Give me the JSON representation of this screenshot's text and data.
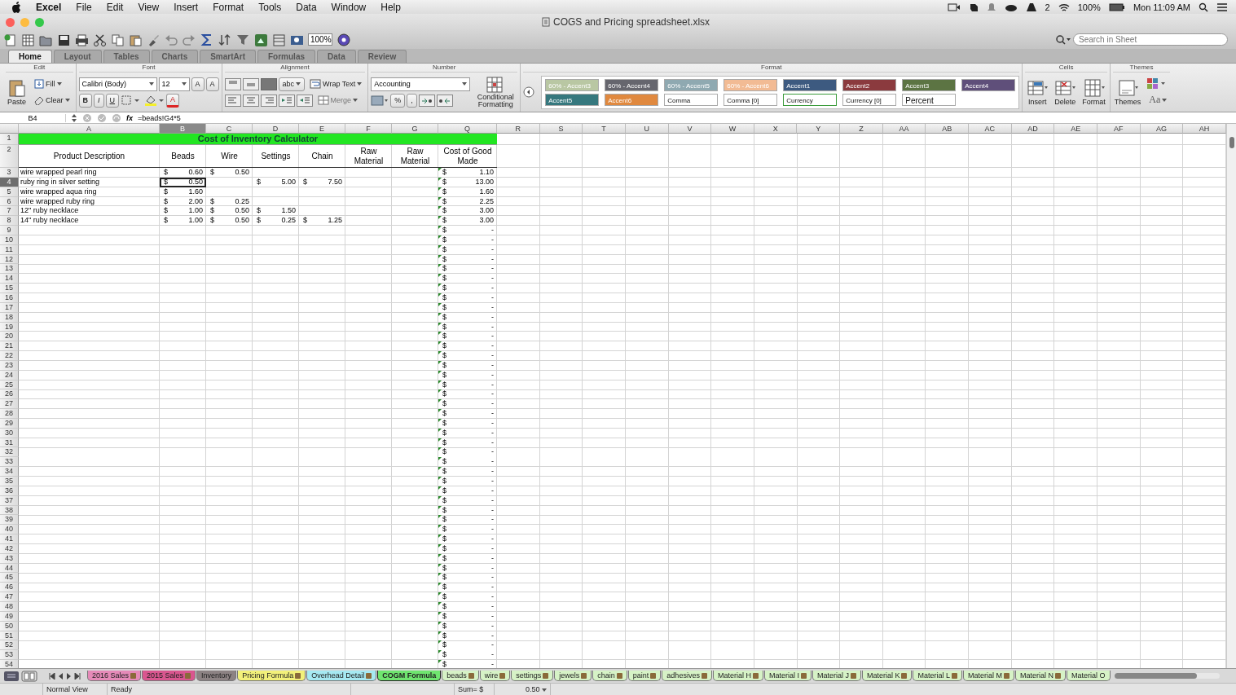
{
  "menubar": {
    "app": "Excel",
    "items": [
      "File",
      "Edit",
      "View",
      "Insert",
      "Format",
      "Tools",
      "Data",
      "Window",
      "Help"
    ],
    "badge": "2",
    "battery": "100%",
    "clock": "Mon 11:09 AM"
  },
  "window": {
    "title": "COGS and Pricing spreadsheet.xlsx"
  },
  "toolbar": {
    "zoom": "100%",
    "search": {
      "placeholder": "Search in Sheet"
    }
  },
  "ribbon_tabs": [
    {
      "label": "Home",
      "selected": true
    },
    {
      "label": "Layout",
      "selected": false
    },
    {
      "label": "Tables",
      "selected": false
    },
    {
      "label": "Charts",
      "selected": false
    },
    {
      "label": "SmartArt",
      "selected": false
    },
    {
      "label": "Formulas",
      "selected": false
    },
    {
      "label": "Data",
      "selected": false
    },
    {
      "label": "Review",
      "selected": false
    }
  ],
  "ribbon": {
    "groups": [
      "Edit",
      "Font",
      "Alignment",
      "Number",
      "Format",
      "Cells",
      "Themes"
    ],
    "paste": "Paste",
    "fill": "Fill",
    "clear": "Clear",
    "font_name": "Calibri (Body)",
    "font_size": "12",
    "grow_font": "A",
    "shrink_font": "A",
    "bold": "B",
    "italic": "I",
    "underline": "U",
    "font_color": "A",
    "orientation": "abc",
    "wrap_text": "Wrap Text",
    "merge": "Merge",
    "number_format": "Accounting",
    "percent": "%",
    "comma": ",",
    "conditional_formatting": "Conditional Formatting",
    "styles": [
      {
        "label": "60% - Accent3",
        "color": "#b9c7a3",
        "selected": false
      },
      {
        "label": "60% - Accent4",
        "color": "#66666e",
        "selected": false
      },
      {
        "label": "60% - Accent5",
        "color": "#8fa9b1",
        "selected": false
      },
      {
        "label": "60% - Accent6",
        "color": "#f2bb94",
        "selected": false
      },
      {
        "label": "Accent1",
        "color": "#3d5a80",
        "selected": false
      },
      {
        "label": "Accent2",
        "color": "#8b3a3e",
        "selected": false
      },
      {
        "label": "Accent3",
        "color": "#5c7443",
        "selected": false
      },
      {
        "label": "Accent4",
        "color": "#5f4f7a",
        "selected": false
      },
      {
        "label": "Accent5",
        "color": "#36787e",
        "selected": false
      },
      {
        "label": "Accent6",
        "color": "#e0893f",
        "selected": false
      },
      {
        "label": "Comma",
        "color": "#ffffff",
        "selected": false
      },
      {
        "label": "Comma [0]",
        "color": "#ffffff",
        "selected": false
      },
      {
        "label": "Currency",
        "color": "#ffffff",
        "selected": true
      },
      {
        "label": "Currency [0]",
        "color": "#ffffff",
        "selected": false
      },
      {
        "label": "Percent",
        "color": "#ffffff",
        "selected": false
      }
    ],
    "insert": "Insert",
    "delete": "Delete",
    "format": "Format",
    "themes": "Themes",
    "theme_fonts": "Aa"
  },
  "formula_bar": {
    "name_box": "B4",
    "fx": "fx",
    "formula": "=beads!G4*5"
  },
  "columns": [
    {
      "label": "A",
      "selected": false
    },
    {
      "label": "B",
      "selected": true
    },
    {
      "label": "C",
      "selected": false
    },
    {
      "label": "D",
      "selected": false
    },
    {
      "label": "E",
      "selected": false
    },
    {
      "label": "F",
      "selected": false
    },
    {
      "label": "G",
      "selected": false
    },
    {
      "label": "Q",
      "selected": false
    },
    {
      "label": "R",
      "selected": false
    },
    {
      "label": "S",
      "selected": false
    },
    {
      "label": "T",
      "selected": false
    },
    {
      "label": "U",
      "selected": false
    },
    {
      "label": "V",
      "selected": false
    },
    {
      "label": "W",
      "selected": false
    },
    {
      "label": "X",
      "selected": false
    },
    {
      "label": "Y",
      "selected": false
    },
    {
      "label": "Z",
      "selected": false
    },
    {
      "label": "AA",
      "selected": false
    },
    {
      "label": "AB",
      "selected": false
    },
    {
      "label": "AC",
      "selected": false
    },
    {
      "label": "AD",
      "selected": false
    },
    {
      "label": "AE",
      "selected": false
    },
    {
      "label": "AF",
      "selected": false
    },
    {
      "label": "AG",
      "selected": false
    },
    {
      "label": "AH",
      "selected": false
    }
  ],
  "rows": [
    {
      "kind": "title",
      "num": "1",
      "selected": false,
      "title": "Cost of Inventory Calculator"
    },
    {
      "kind": "header",
      "num": "2",
      "selected": false,
      "headings": [
        "Product Description",
        "Beads",
        "Wire",
        "Settings",
        "Chain",
        "Raw Material",
        "Raw Material",
        "Cost of Good Made"
      ]
    },
    {
      "kind": "data",
      "num": "3",
      "selected": false,
      "description": "wire wrapped pearl ring",
      "beads": {
        "sym": "$",
        "val": "0.60"
      },
      "wire": {
        "sym": "$",
        "val": "0.50"
      },
      "cogs": {
        "sym": "$",
        "val": "1.10",
        "flagged": true
      }
    },
    {
      "kind": "data",
      "num": "4",
      "selected": true,
      "description": "ruby ring in silver setting",
      "beads": {
        "sym": "$",
        "val": "0.50"
      },
      "settings": {
        "sym": "$",
        "val": "5.00"
      },
      "chain": {
        "sym": "$",
        "val": "7.50"
      },
      "cogs": {
        "sym": "$",
        "val": "13.00",
        "flagged": true
      }
    },
    {
      "kind": "data",
      "num": "5",
      "selected": false,
      "description": "wire wrapped aqua ring",
      "beads": {
        "sym": "$",
        "val": "1.60"
      },
      "cogs": {
        "sym": "$",
        "val": "1.60",
        "flagged": true
      }
    },
    {
      "kind": "data",
      "num": "6",
      "selected": false,
      "description": "wire wrapped ruby ring",
      "beads": {
        "sym": "$",
        "val": "2.00"
      },
      "wire": {
        "sym": "$",
        "val": "0.25"
      },
      "cogs": {
        "sym": "$",
        "val": "2.25",
        "flagged": true
      }
    },
    {
      "kind": "data",
      "num": "7",
      "selected": false,
      "description": "12\" ruby necklace",
      "beads": {
        "sym": "$",
        "val": "1.00"
      },
      "wire": {
        "sym": "$",
        "val": "0.50"
      },
      "settings": {
        "sym": "$",
        "val": "1.50"
      },
      "cogs": {
        "sym": "$",
        "val": "3.00",
        "flagged": true
      }
    },
    {
      "kind": "data",
      "num": "8",
      "selected": false,
      "description": "14\" ruby necklace",
      "beads": {
        "sym": "$",
        "val": "1.00"
      },
      "wire": {
        "sym": "$",
        "val": "0.50"
      },
      "settings": {
        "sym": "$",
        "val": "0.25"
      },
      "chain": {
        "sym": "$",
        "val": "1.25"
      },
      "cogs": {
        "sym": "$",
        "val": "3.00",
        "flagged": true
      }
    },
    {
      "kind": "data",
      "num": "9",
      "selected": false,
      "cogs": {
        "sym": "$",
        "val": "-",
        "flagged": true
      }
    },
    {
      "kind": "data",
      "num": "10",
      "selected": false,
      "cogs": {
        "sym": "$",
        "val": "-",
        "flagged": true
      }
    },
    {
      "kind": "data",
      "num": "11",
      "selected": false,
      "cogs": {
        "sym": "$",
        "val": "-",
        "flagged": true
      }
    },
    {
      "kind": "data",
      "num": "12",
      "selected": false,
      "cogs": {
        "sym": "$",
        "val": "-",
        "flagged": true
      }
    },
    {
      "kind": "data",
      "num": "13",
      "selected": false,
      "cogs": {
        "sym": "$",
        "val": "-",
        "flagged": true
      }
    },
    {
      "kind": "data",
      "num": "14",
      "selected": false,
      "cogs": {
        "sym": "$",
        "val": "-",
        "flagged": true
      }
    },
    {
      "kind": "data",
      "num": "15",
      "selected": false,
      "cogs": {
        "sym": "$",
        "val": "-",
        "flagged": true
      }
    },
    {
      "kind": "data",
      "num": "16",
      "selected": false,
      "cogs": {
        "sym": "$",
        "val": "-",
        "flagged": true
      }
    },
    {
      "kind": "data",
      "num": "17",
      "selected": false,
      "cogs": {
        "sym": "$",
        "val": "-",
        "flagged": true
      }
    },
    {
      "kind": "data",
      "num": "18",
      "selected": false,
      "cogs": {
        "sym": "$",
        "val": "-",
        "flagged": true
      }
    },
    {
      "kind": "data",
      "num": "19",
      "selected": false,
      "cogs": {
        "sym": "$",
        "val": "-",
        "flagged": true
      }
    },
    {
      "kind": "data",
      "num": "20",
      "selected": false,
      "cogs": {
        "sym": "$",
        "val": "-",
        "flagged": true
      }
    },
    {
      "kind": "data",
      "num": "21",
      "selected": false,
      "cogs": {
        "sym": "$",
        "val": "-",
        "flagged": true
      }
    },
    {
      "kind": "data",
      "num": "22",
      "selected": false,
      "cogs": {
        "sym": "$",
        "val": "-",
        "flagged": true
      }
    },
    {
      "kind": "data",
      "num": "23",
      "selected": false,
      "cogs": {
        "sym": "$",
        "val": "-",
        "flagged": true
      }
    },
    {
      "kind": "data",
      "num": "24",
      "selected": false,
      "cogs": {
        "sym": "$",
        "val": "-",
        "flagged": true
      }
    },
    {
      "kind": "data",
      "num": "25",
      "selected": false,
      "cogs": {
        "sym": "$",
        "val": "-",
        "flagged": true
      }
    },
    {
      "kind": "data",
      "num": "26",
      "selected": false,
      "cogs": {
        "sym": "$",
        "val": "-",
        "flagged": true
      }
    },
    {
      "kind": "data",
      "num": "27",
      "selected": false,
      "cogs": {
        "sym": "$",
        "val": "-",
        "flagged": true
      }
    },
    {
      "kind": "data",
      "num": "28",
      "selected": false,
      "cogs": {
        "sym": "$",
        "val": "-",
        "flagged": true
      }
    },
    {
      "kind": "data",
      "num": "29",
      "selected": false,
      "cogs": {
        "sym": "$",
        "val": "-",
        "flagged": true
      }
    },
    {
      "kind": "data",
      "num": "30",
      "selected": false,
      "cogs": {
        "sym": "$",
        "val": "-",
        "flagged": true
      }
    },
    {
      "kind": "data",
      "num": "31",
      "selected": false,
      "cogs": {
        "sym": "$",
        "val": "-",
        "flagged": true
      }
    },
    {
      "kind": "data",
      "num": "32",
      "selected": false,
      "cogs": {
        "sym": "$",
        "val": "-",
        "flagged": true
      }
    },
    {
      "kind": "data",
      "num": "33",
      "selected": false,
      "cogs": {
        "sym": "$",
        "val": "-",
        "flagged": true
      }
    },
    {
      "kind": "data",
      "num": "34",
      "selected": false,
      "cogs": {
        "sym": "$",
        "val": "-",
        "flagged": true
      }
    },
    {
      "kind": "data",
      "num": "35",
      "selected": false,
      "cogs": {
        "sym": "$",
        "val": "-",
        "flagged": true
      }
    },
    {
      "kind": "data",
      "num": "36",
      "selected": false,
      "cogs": {
        "sym": "$",
        "val": "-",
        "flagged": true
      }
    },
    {
      "kind": "data",
      "num": "37",
      "selected": false,
      "cogs": {
        "sym": "$",
        "val": "-",
        "flagged": true
      }
    },
    {
      "kind": "data",
      "num": "38",
      "selected": false,
      "cogs": {
        "sym": "$",
        "val": "-",
        "flagged": true
      }
    },
    {
      "kind": "data",
      "num": "39",
      "selected": false,
      "cogs": {
        "sym": "$",
        "val": "-",
        "flagged": true
      }
    },
    {
      "kind": "data",
      "num": "40",
      "selected": false,
      "cogs": {
        "sym": "$",
        "val": "-",
        "flagged": true
      }
    },
    {
      "kind": "data",
      "num": "41",
      "selected": false,
      "cogs": {
        "sym": "$",
        "val": "-",
        "flagged": true
      }
    },
    {
      "kind": "data",
      "num": "42",
      "selected": false,
      "cogs": {
        "sym": "$",
        "val": "-",
        "flagged": true
      }
    },
    {
      "kind": "data",
      "num": "43",
      "selected": false,
      "cogs": {
        "sym": "$",
        "val": "-",
        "flagged": true
      }
    },
    {
      "kind": "data",
      "num": "44",
      "selected": false,
      "cogs": {
        "sym": "$",
        "val": "-",
        "flagged": true
      }
    },
    {
      "kind": "data",
      "num": "45",
      "selected": false,
      "cogs": {
        "sym": "$",
        "val": "-",
        "flagged": true
      }
    },
    {
      "kind": "data",
      "num": "46",
      "selected": false,
      "cogs": {
        "sym": "$",
        "val": "-",
        "flagged": true
      }
    },
    {
      "kind": "data",
      "num": "47",
      "selected": false,
      "cogs": {
        "sym": "$",
        "val": "-",
        "flagged": true
      }
    },
    {
      "kind": "data",
      "num": "48",
      "selected": false,
      "cogs": {
        "sym": "$",
        "val": "-",
        "flagged": true
      }
    },
    {
      "kind": "data",
      "num": "49",
      "selected": false,
      "cogs": {
        "sym": "$",
        "val": "-",
        "flagged": true
      }
    },
    {
      "kind": "data",
      "num": "50",
      "selected": false,
      "cogs": {
        "sym": "$",
        "val": "-",
        "flagged": true
      }
    },
    {
      "kind": "data",
      "num": "51",
      "selected": false,
      "cogs": {
        "sym": "$",
        "val": "-",
        "flagged": true
      }
    },
    {
      "kind": "data",
      "num": "52",
      "selected": false,
      "cogs": {
        "sym": "$",
        "val": "-",
        "flagged": true
      }
    },
    {
      "kind": "data",
      "num": "53",
      "selected": false,
      "cogs": {
        "sym": "$",
        "val": "-",
        "flagged": true
      }
    },
    {
      "kind": "data",
      "num": "54",
      "selected": false,
      "cogs": {
        "sym": "$",
        "val": "-",
        "flagged": true
      }
    }
  ],
  "sheet_tabs": [
    {
      "label": "2016 Sales",
      "color": "#e58ab8",
      "locked": true,
      "selected": false
    },
    {
      "label": "2015 Sales",
      "color": "#d9568f",
      "locked": true,
      "selected": false
    },
    {
      "label": "Inventory",
      "color": "#8c8283",
      "locked": false,
      "selected": false
    },
    {
      "label": "Pricing Formula",
      "color": "#f2f07a",
      "locked": true,
      "selected": false
    },
    {
      "label": "Overhead Detail",
      "color": "#a6e9f2",
      "locked": true,
      "selected": false
    },
    {
      "label": "COGM Formula",
      "color": "#6fe46f",
      "locked": false,
      "selected": true
    },
    {
      "label": "beads",
      "color": "#d6f2c6",
      "locked": true,
      "selected": false
    },
    {
      "label": "wire",
      "color": "#d6f2c6",
      "locked": true,
      "selected": false
    },
    {
      "label": "settings",
      "color": "#d6f2c6",
      "locked": true,
      "selected": false
    },
    {
      "label": "jewels",
      "color": "#d6f2c6",
      "locked": true,
      "selected": false
    },
    {
      "label": "chain",
      "color": "#d6f2c6",
      "locked": true,
      "selected": false
    },
    {
      "label": "paint",
      "color": "#d6f2c6",
      "locked": true,
      "selected": false
    },
    {
      "label": "adhesives",
      "color": "#d6f2c6",
      "locked": true,
      "selected": false
    },
    {
      "label": "Material H",
      "color": "#d6f2c6",
      "locked": true,
      "selected": false
    },
    {
      "label": "Material I",
      "color": "#d6f2c6",
      "locked": true,
      "selected": false
    },
    {
      "label": "Material J",
      "color": "#d6f2c6",
      "locked": true,
      "selected": false
    },
    {
      "label": "Material K",
      "color": "#d6f2c6",
      "locked": true,
      "selected": false
    },
    {
      "label": "Material L",
      "color": "#d6f2c6",
      "locked": true,
      "selected": false
    },
    {
      "label": "Material M",
      "color": "#d6f2c6",
      "locked": true,
      "selected": false
    },
    {
      "label": "Material N",
      "color": "#d6f2c6",
      "locked": true,
      "selected": false
    },
    {
      "label": "Material O",
      "color": "#d6f2c6",
      "locked": false,
      "selected": false
    }
  ],
  "status_bar": {
    "view": "Normal View",
    "mode": "Ready",
    "sum_label": "Sum= $",
    "sum_value": "0.50"
  }
}
